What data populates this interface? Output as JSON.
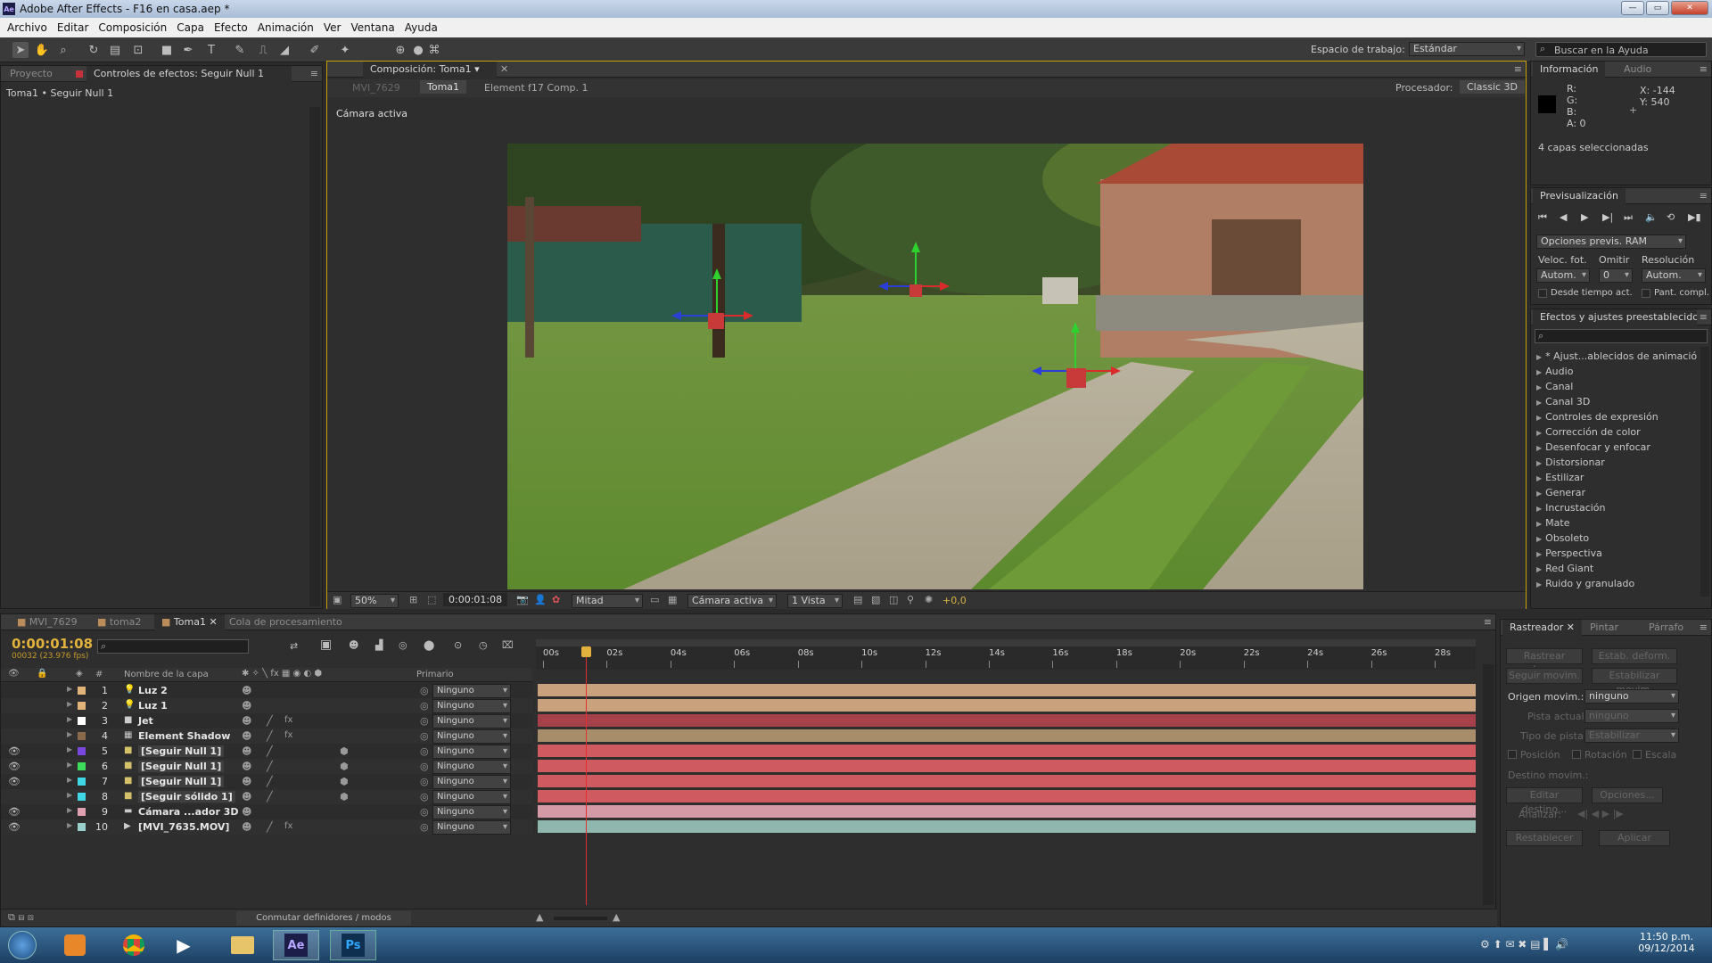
{
  "window": {
    "title": "Adobe After Effects - F16 en casa.aep *",
    "app_badge": "Ae",
    "min": "—",
    "max": "▭",
    "close": "✕"
  },
  "menu": [
    "Archivo",
    "Editar",
    "Composición",
    "Capa",
    "Efecto",
    "Animación",
    "Ver",
    "Ventana",
    "Ayuda"
  ],
  "toolbar": {
    "workspace_label": "Espacio de trabajo:",
    "workspace_value": "Estándar",
    "help_placeholder": "Buscar en la Ayuda"
  },
  "left_panel": {
    "tabs": [
      "Proyecto",
      "Controles de efectos: Seguir Null 1"
    ],
    "breadcrumb": "Toma1 • Seguir Null 1"
  },
  "comp": {
    "tab": "Composición: Toma1",
    "nav_tabs": [
      "MVI_7629",
      "Toma1",
      "Element f17 Comp. 1"
    ],
    "renderer_label": "Procesador:",
    "renderer_value": "Classic 3D",
    "view_label": "Cámara activa",
    "zoom": "50%",
    "timecode": "0:00:01:08",
    "resolution": "Mitad",
    "camera": "Cámara activa",
    "views": "1 Vista",
    "exposure": "+0,0"
  },
  "info": {
    "tabs": [
      "Información",
      "Audio"
    ],
    "r": "R:",
    "g": "G:",
    "b": "B:",
    "a": "A: 0",
    "x": "X: -144",
    "y": "Y: 540",
    "layers": "4 capas seleccionadas"
  },
  "preview": {
    "tab": "Previsualización",
    "ram_options": "Opciones previs. RAM",
    "fps_label": "Veloc. fot.",
    "skip_label": "Omitir",
    "res_label": "Resolución",
    "fps_value": "Autom.",
    "skip_value": "0",
    "res_value": "Autom.",
    "from_current": "Desde tiempo act.",
    "fullscreen": "Pant. compl."
  },
  "effects": {
    "tab": "Efectos y ajustes preestablecidos",
    "items": [
      "* Ajust...ablecidos de animación",
      "Audio",
      "Canal",
      "Canal 3D",
      "Controles de expresión",
      "Corrección de color",
      "Desenfocar y enfocar",
      "Distorsionar",
      "Estilizar",
      "Generar",
      "Incrustación",
      "Mate",
      "Obsoleto",
      "Perspectiva",
      "Red Giant",
      "Ruido y granulado"
    ]
  },
  "timeline": {
    "tabs": [
      "MVI_7629",
      "toma2",
      "Toma1",
      "Cola de procesamiento"
    ],
    "timecode": "0:00:01:08",
    "frames": "00032 (23.976 fps)",
    "col_name": "Nombre de la capa",
    "col_hash": "#",
    "col_parent": "Primario",
    "ruler": [
      "00s",
      "02s",
      "04s",
      "06s",
      "08s",
      "10s",
      "12s",
      "14s",
      "16s",
      "18s",
      "20s",
      "22s",
      "24s",
      "26s",
      "28s"
    ],
    "playhead_time_s": 1.35,
    "toggle_label": "Conmutar definidores / modos",
    "layers": [
      {
        "num": "1",
        "name": "Luz 2",
        "label": "#e3b47a",
        "type": "light",
        "bar": "#c9a27d",
        "parent": "Ninguno",
        "eye": false
      },
      {
        "num": "2",
        "name": "Luz 1",
        "label": "#e3b47a",
        "type": "light",
        "bar": "#c9a27d",
        "parent": "Ninguno",
        "eye": false
      },
      {
        "num": "3",
        "name": "Jet",
        "label": "#ffffff",
        "type": "solid",
        "bar": "#a6404a",
        "parent": "Ninguno",
        "eye": false
      },
      {
        "num": "4",
        "name": "Element Shadow",
        "label": "#8a6a4a",
        "type": "comp",
        "bar": "#a88d6a",
        "parent": "Ninguno",
        "eye": false
      },
      {
        "num": "5",
        "name": "[Seguir Null 1]",
        "label": "#7a47e0",
        "type": "null",
        "bar": "#cf5a5f",
        "parent": "Ninguno",
        "eye": true
      },
      {
        "num": "6",
        "name": "[Seguir Null 1]",
        "label": "#3ddc5a",
        "type": "null",
        "bar": "#cf5a5f",
        "parent": "Ninguno",
        "eye": true
      },
      {
        "num": "7",
        "name": "[Seguir Null 1]",
        "label": "#3fd6e6",
        "type": "null",
        "bar": "#cf5a5f",
        "parent": "Ninguno",
        "eye": true
      },
      {
        "num": "8",
        "name": "[Seguir sólido 1]",
        "label": "#3fd6e6",
        "type": "null",
        "bar": "#cf5a5f",
        "parent": "Ninguno",
        "eye": false
      },
      {
        "num": "9",
        "name": "Cámara ...ador 3D",
        "label": "#e0a0b0",
        "type": "camera",
        "bar": "#d49aa6",
        "parent": "Ninguno",
        "eye": true
      },
      {
        "num": "10",
        "name": "[MVI_7635.MOV]",
        "label": "#9ad0cc",
        "type": "video",
        "bar": "#8fb7ad",
        "parent": "Ninguno",
        "eye": true
      }
    ]
  },
  "tracker": {
    "tabs": [
      "Rastreador",
      "Pintar",
      "Párrafo"
    ],
    "track_camera": "Rastrear cámara",
    "warp": "Estab. deform.",
    "track_motion": "Seguir movim.",
    "stabilize": "Estabilizar movim.",
    "source_label": "Origen movim.:",
    "source_value": "ninguno",
    "current_label": "Pista actual:",
    "current_value": "ninguno",
    "type_label": "Tipo de pista:",
    "type_value": "Estabilizar",
    "position": "Posición",
    "rotation": "Rotación",
    "scale": "Escala",
    "target": "Destino movim.:",
    "edit_target": "Editar destino...",
    "options": "Opciones...",
    "analyze": "Analizar:",
    "reset": "Restablecer",
    "apply": "Aplicar"
  },
  "taskbar": {
    "time": "11:50 p.m.",
    "date": "09/12/2014",
    "ae": "Ae",
    "ps": "Ps"
  }
}
